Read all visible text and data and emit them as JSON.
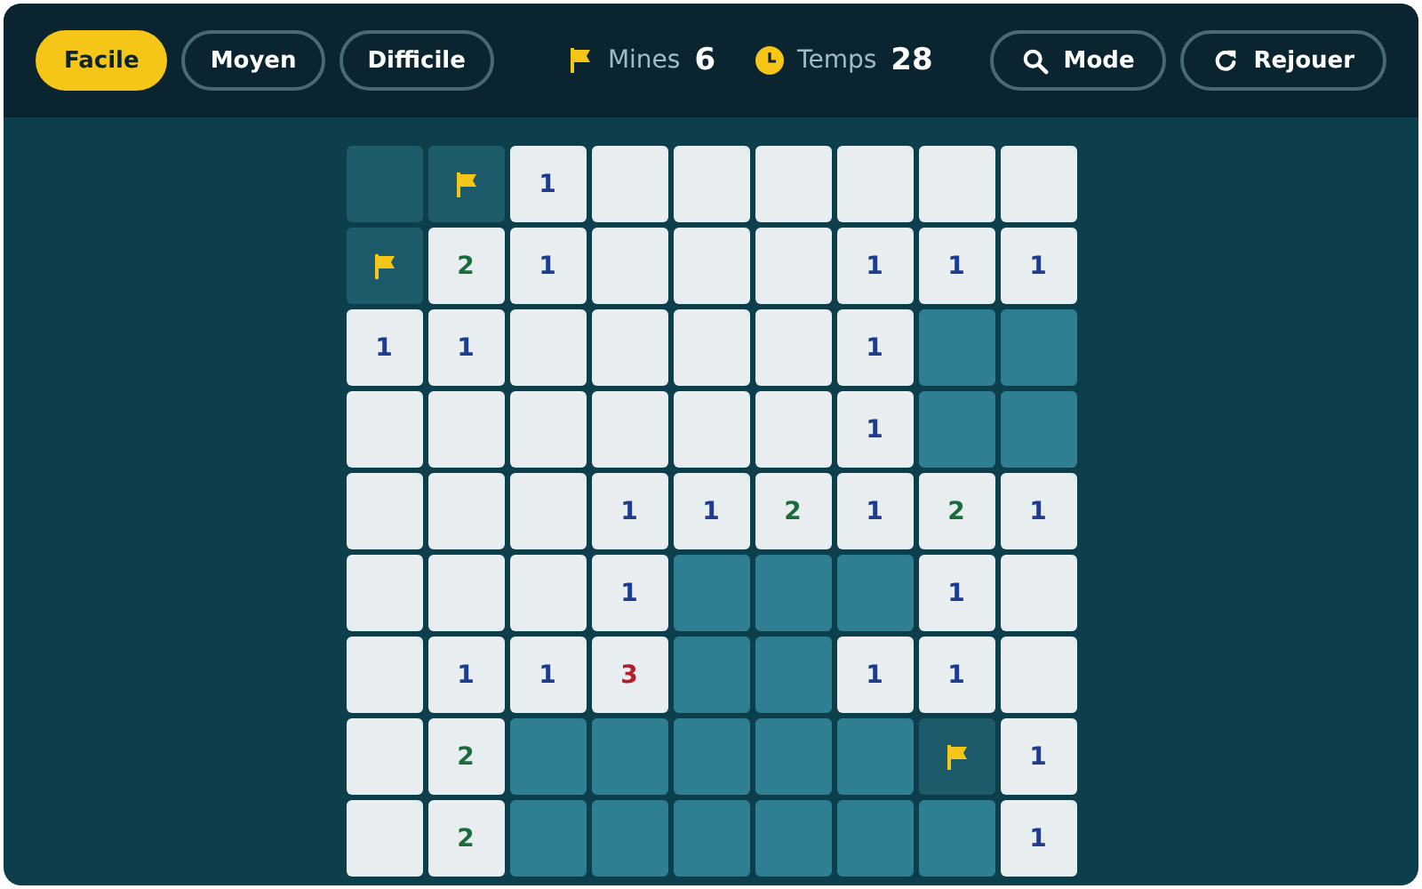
{
  "difficulties": [
    {
      "label": "Facile",
      "selected": true
    },
    {
      "label": "Moyen",
      "selected": false
    },
    {
      "label": "Difficile",
      "selected": false
    }
  ],
  "stats": [
    {
      "kind": "mines",
      "label": "Mines",
      "value": "6"
    },
    {
      "kind": "time",
      "label": "Temps",
      "value": "28"
    }
  ],
  "actions": [
    {
      "kind": "mode",
      "label": "Mode"
    },
    {
      "kind": "replay",
      "label": "Rejouer"
    }
  ],
  "board": [
    [
      {
        "kind": "shaded"
      },
      {
        "kind": "flagged"
      },
      {
        "kind": "open",
        "text": "1"
      },
      {
        "kind": "open"
      },
      {
        "kind": "open"
      },
      {
        "kind": "open"
      },
      {
        "kind": "open"
      },
      {
        "kind": "open"
      },
      {
        "kind": "open"
      }
    ],
    [
      {
        "kind": "flagged"
      },
      {
        "kind": "open",
        "text": "2"
      },
      {
        "kind": "open",
        "text": "1"
      },
      {
        "kind": "open"
      },
      {
        "kind": "open"
      },
      {
        "kind": "open"
      },
      {
        "kind": "open",
        "text": "1"
      },
      {
        "kind": "open",
        "text": "1"
      },
      {
        "kind": "open",
        "text": "1"
      }
    ],
    [
      {
        "kind": "open",
        "text": "1"
      },
      {
        "kind": "open",
        "text": "1"
      },
      {
        "kind": "open"
      },
      {
        "kind": "open"
      },
      {
        "kind": "open"
      },
      {
        "kind": "open"
      },
      {
        "kind": "open",
        "text": "1"
      },
      {
        "kind": "hidden"
      },
      {
        "kind": "hidden"
      }
    ],
    [
      {
        "kind": "open"
      },
      {
        "kind": "open"
      },
      {
        "kind": "open"
      },
      {
        "kind": "open"
      },
      {
        "kind": "open"
      },
      {
        "kind": "open"
      },
      {
        "kind": "open",
        "text": "1"
      },
      {
        "kind": "hidden"
      },
      {
        "kind": "hidden"
      }
    ],
    [
      {
        "kind": "open"
      },
      {
        "kind": "open"
      },
      {
        "kind": "open"
      },
      {
        "kind": "open",
        "text": "1"
      },
      {
        "kind": "open",
        "text": "1"
      },
      {
        "kind": "open",
        "text": "2"
      },
      {
        "kind": "open",
        "text": "1"
      },
      {
        "kind": "open",
        "text": "2"
      },
      {
        "kind": "open",
        "text": "1"
      }
    ],
    [
      {
        "kind": "open"
      },
      {
        "kind": "open"
      },
      {
        "kind": "open"
      },
      {
        "kind": "open",
        "text": "1"
      },
      {
        "kind": "hidden"
      },
      {
        "kind": "hidden"
      },
      {
        "kind": "hidden"
      },
      {
        "kind": "open",
        "text": "1"
      },
      {
        "kind": "open"
      }
    ],
    [
      {
        "kind": "open"
      },
      {
        "kind": "open",
        "text": "1"
      },
      {
        "kind": "open",
        "text": "1"
      },
      {
        "kind": "open",
        "text": "3"
      },
      {
        "kind": "hidden"
      },
      {
        "kind": "hidden"
      },
      {
        "kind": "open",
        "text": "1"
      },
      {
        "kind": "open",
        "text": "1"
      },
      {
        "kind": "open"
      }
    ],
    [
      {
        "kind": "open"
      },
      {
        "kind": "open",
        "text": "2"
      },
      {
        "kind": "hidden"
      },
      {
        "kind": "hidden"
      },
      {
        "kind": "hidden"
      },
      {
        "kind": "hidden"
      },
      {
        "kind": "hidden"
      },
      {
        "kind": "flagged"
      },
      {
        "kind": "open",
        "text": "1"
      }
    ],
    [
      {
        "kind": "open"
      },
      {
        "kind": "open",
        "text": "2"
      },
      {
        "kind": "hidden"
      },
      {
        "kind": "hidden"
      },
      {
        "kind": "hidden"
      },
      {
        "kind": "hidden"
      },
      {
        "kind": "hidden"
      },
      {
        "kind": "hidden"
      },
      {
        "kind": "open",
        "text": "1"
      }
    ]
  ]
}
